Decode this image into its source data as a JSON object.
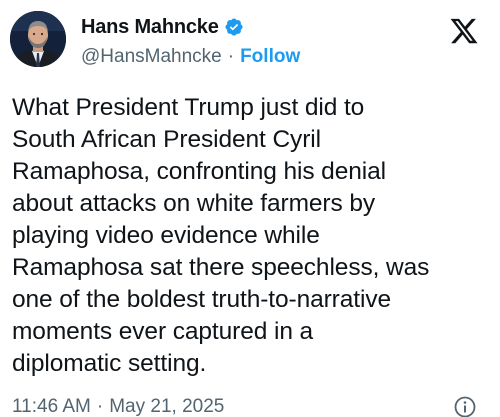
{
  "author": {
    "display_name": "Hans Mahncke",
    "handle": "@HansMahncke",
    "separator": "·",
    "follow_label": "Follow",
    "verified_icon": "verified-badge-icon",
    "avatar_icon": "profile-photo"
  },
  "platform": {
    "logo_icon": "x-logo-icon"
  },
  "tweet": {
    "text": "What President Trump just did to\nSouth African President Cyril\nRamaphosa, confronting his denial\nabout attacks on white farmers by\nplaying video evidence while\nRamaphosa sat there speechless, was\none of the boldest truth-to-narrative\nmoments ever captured in a\ndiplomatic setting."
  },
  "meta": {
    "time": "11:46 AM",
    "separator": "·",
    "date": "May 21, 2025",
    "info_icon": "info-icon"
  },
  "colors": {
    "accent": "#1d9bf0",
    "text_primary": "#0f1419",
    "text_secondary": "#536471"
  }
}
